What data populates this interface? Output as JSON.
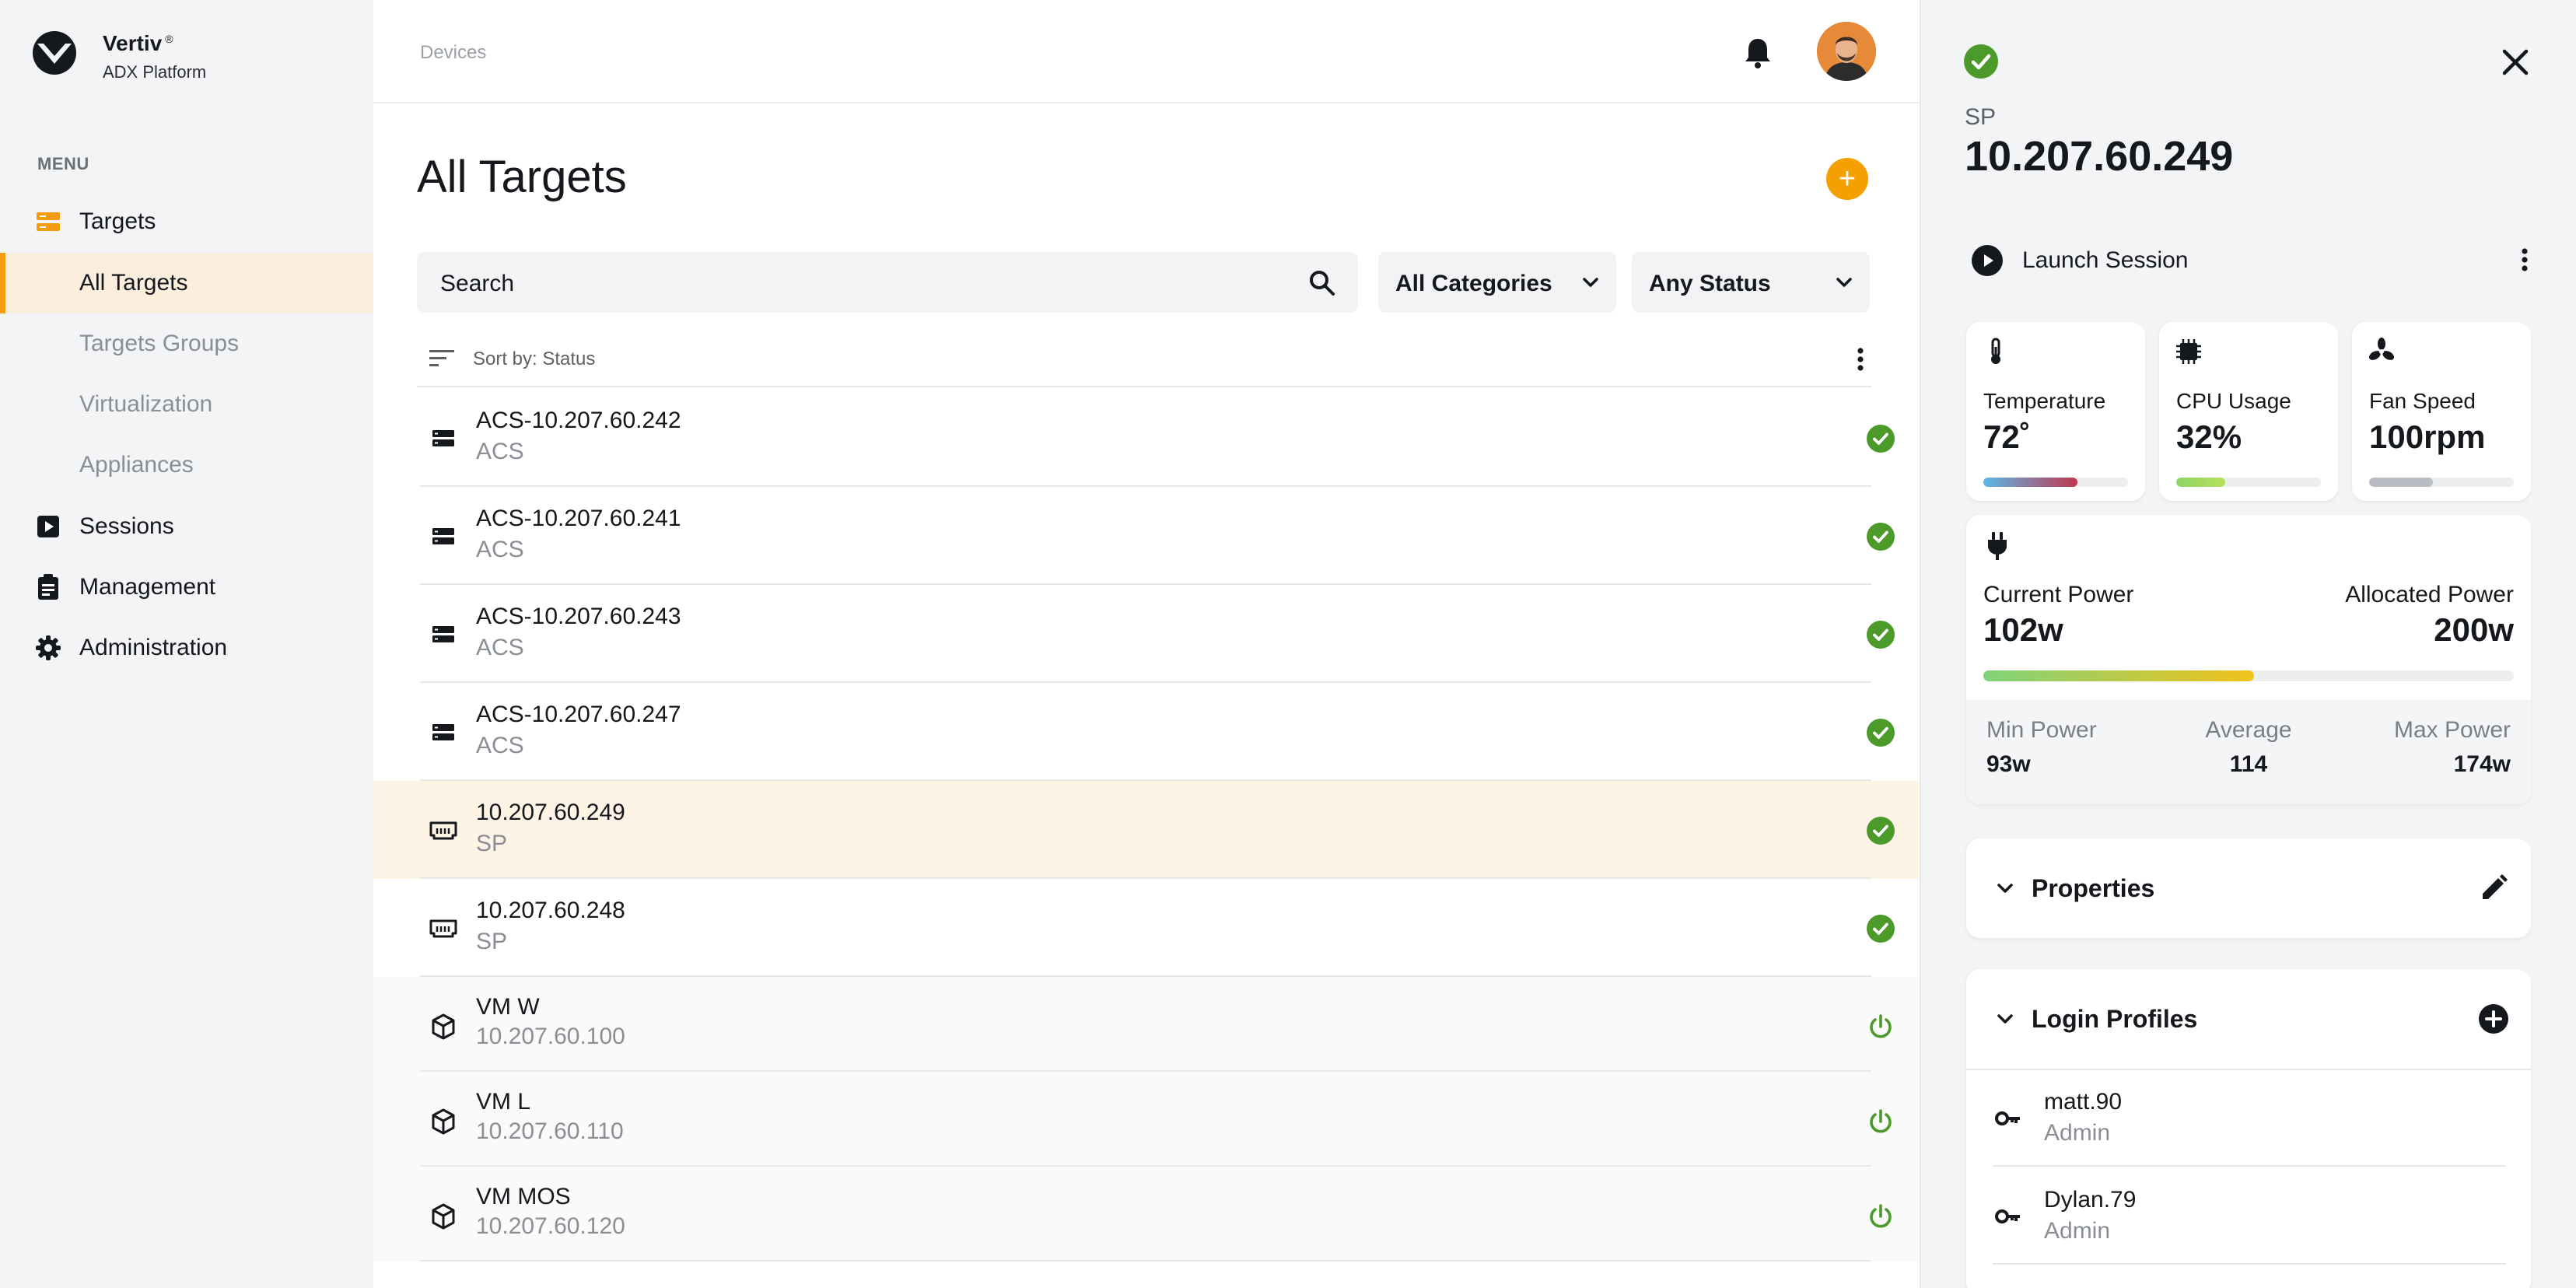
{
  "brand": {
    "name": "Vertiv",
    "trademark": "®",
    "subtitle": "ADX Platform"
  },
  "sidebar": {
    "menu_heading": "MENU",
    "items": [
      {
        "label": "Targets",
        "icon": "targets-icon",
        "active_parent": true
      },
      {
        "label": "All Targets",
        "sub": true,
        "active": true
      },
      {
        "label": "Targets Groups",
        "sub": true
      },
      {
        "label": "Virtualization",
        "sub": true
      },
      {
        "label": "Appliances",
        "sub": true
      },
      {
        "label": "Sessions",
        "icon": "play-box-icon"
      },
      {
        "label": "Management",
        "icon": "clipboard-icon"
      },
      {
        "label": "Administration",
        "icon": "gear-icon"
      }
    ]
  },
  "header": {
    "breadcrumb": "Devices",
    "notification_icon": "bell-icon",
    "avatar_icon": "user-avatar"
  },
  "main": {
    "title": "All Targets",
    "add_button": "+",
    "search": {
      "placeholder": "Search"
    },
    "filters": {
      "category": "All Categories",
      "status": "Any Status"
    },
    "sort_label": "Sort by: Status",
    "rows": [
      {
        "title": "ACS-10.207.60.242",
        "subtitle": "ACS",
        "type": "server",
        "status": "ok"
      },
      {
        "title": "ACS-10.207.60.241",
        "subtitle": "ACS",
        "type": "server",
        "status": "ok"
      },
      {
        "title": "ACS-10.207.60.243",
        "subtitle": "ACS",
        "type": "server",
        "status": "ok"
      },
      {
        "title": "ACS-10.207.60.247",
        "subtitle": "ACS",
        "type": "server",
        "status": "ok"
      },
      {
        "title": "10.207.60.249",
        "subtitle": "SP",
        "type": "sp",
        "status": "ok",
        "selected": true
      },
      {
        "title": "10.207.60.248",
        "subtitle": "SP",
        "type": "sp",
        "status": "ok"
      },
      {
        "title": "VM W",
        "subtitle": "10.207.60.100",
        "type": "vm",
        "status": "power"
      },
      {
        "title": "VM L",
        "subtitle": "10.207.60.110",
        "type": "vm",
        "status": "power"
      },
      {
        "title": "VM MOS",
        "subtitle": "10.207.60.120",
        "type": "vm",
        "status": "power"
      }
    ]
  },
  "panel": {
    "type": "SP",
    "ip": "10.207.60.249",
    "launch_label": "Launch Session",
    "metrics": [
      {
        "label": "Temperature",
        "value": "72˚",
        "icon": "thermometer-icon",
        "level": 0.65
      },
      {
        "label": "CPU Usage",
        "value": "32%",
        "icon": "chip-icon",
        "level": 0.34
      },
      {
        "label": "Fan Speed",
        "value": "100rpm",
        "icon": "fan-icon",
        "level": 0.44
      }
    ],
    "power": {
      "current_label": "Current Power",
      "current_value": "102w",
      "allocated_label": "Allocated Power",
      "allocated_value": "200w",
      "level": 0.51,
      "min_label": "Min Power",
      "min_value": "93w",
      "avg_label": "Average",
      "avg_value": "114",
      "max_label": "Max Power",
      "max_value": "174w"
    },
    "properties_title": "Properties",
    "login_profiles_title": "Login Profiles",
    "login_profiles": [
      {
        "name": "matt.90",
        "role": "Admin"
      },
      {
        "name": "Dylan.79",
        "role": "Admin"
      }
    ]
  },
  "colors": {
    "accent": "#f39c12",
    "fab": "#f5a000",
    "status_ok": "#4c9a2a",
    "selected_row": "#fef4e6",
    "sidebar_bg": "#f3f4f6"
  }
}
